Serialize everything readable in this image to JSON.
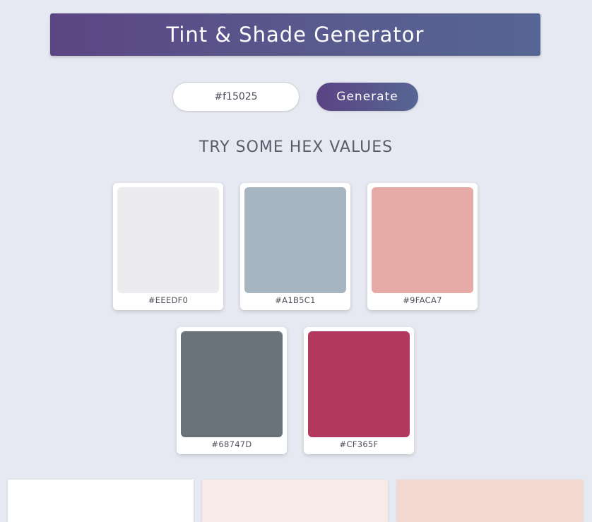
{
  "header": {
    "title": "Tint & Shade Generator",
    "colors": [
      "#5c4584",
      "#566694"
    ]
  },
  "form": {
    "input_value": "#f15025",
    "generate_label": "Generate"
  },
  "samples": {
    "title": "TRY SOME HEX VALUES",
    "items": [
      {
        "label": "#EEEDF0",
        "color": "#ececef"
      },
      {
        "label": "#A1B5C1",
        "color": "#a7b5c0"
      },
      {
        "label": "#9FACA7",
        "color": "#e6aba7"
      },
      {
        "label": "#68747D",
        "color": "#6a727b"
      },
      {
        "label": "#CF365F",
        "color": "#b3385d"
      }
    ]
  },
  "results": {
    "colors": [
      "#ffffff",
      "#f7eae7",
      "#f4d9d0"
    ]
  }
}
